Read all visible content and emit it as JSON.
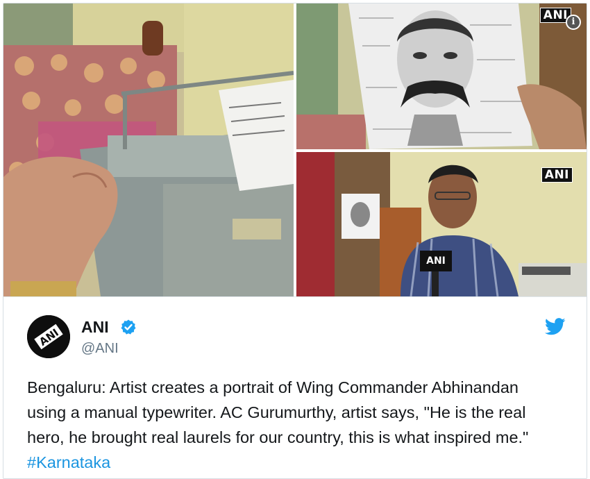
{
  "media": {
    "watermark_portrait": "ANI",
    "watermark_artist": "ANI",
    "mic_flag": "ANI",
    "info_icon": "info-icon"
  },
  "tweet": {
    "display_name": "ANI",
    "handle": "@ANI",
    "avatar_text": "ANI",
    "verified_icon": "verified-badge-icon",
    "platform_icon": "twitter-bird-icon",
    "text": "Bengaluru: Artist creates a portrait of Wing Commander Abhinandan using a manual typewriter. AC Gurumurthy, artist says, \"He is the real hero, he brought real laurels for our country, this is what inspired me.\" ",
    "hashtag": "#Karnataka"
  },
  "colors": {
    "link": "#1b95e0",
    "verified": "#1da1f2",
    "text": "#14171a",
    "secondary": "#657786"
  }
}
